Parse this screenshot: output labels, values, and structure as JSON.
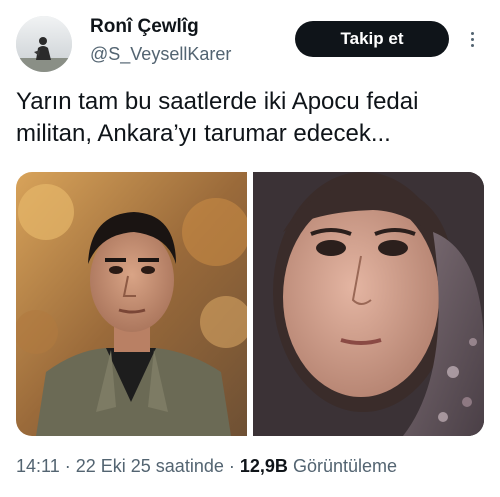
{
  "author": {
    "display_name": "Ronî Çewlîg",
    "handle": "@S_VeysellKarer",
    "avatar_icon": "profile-photo-silhouette"
  },
  "actions": {
    "follow_label": "Takip et",
    "more_icon": "more-vertical-icon"
  },
  "tweet": {
    "text": "Yarın tam bu saatlerde iki Apocu fedai militan, Ankara’yı tarumar edecek..."
  },
  "media": [
    {
      "kind": "photo",
      "depicts": "young man in olive jacket, autumn trees background"
    },
    {
      "kind": "photo",
      "depicts": "woman with headscarf, close-up"
    }
  ],
  "meta": {
    "time": "14:11",
    "separator": "·",
    "date": "22 Eki 25 saatinde",
    "views_count": "12,9B",
    "views_label": "Görüntüleme"
  },
  "colors": {
    "text_primary": "#0f1419",
    "text_secondary": "#536471",
    "button_bg": "#0f1419",
    "button_text": "#ffffff"
  }
}
